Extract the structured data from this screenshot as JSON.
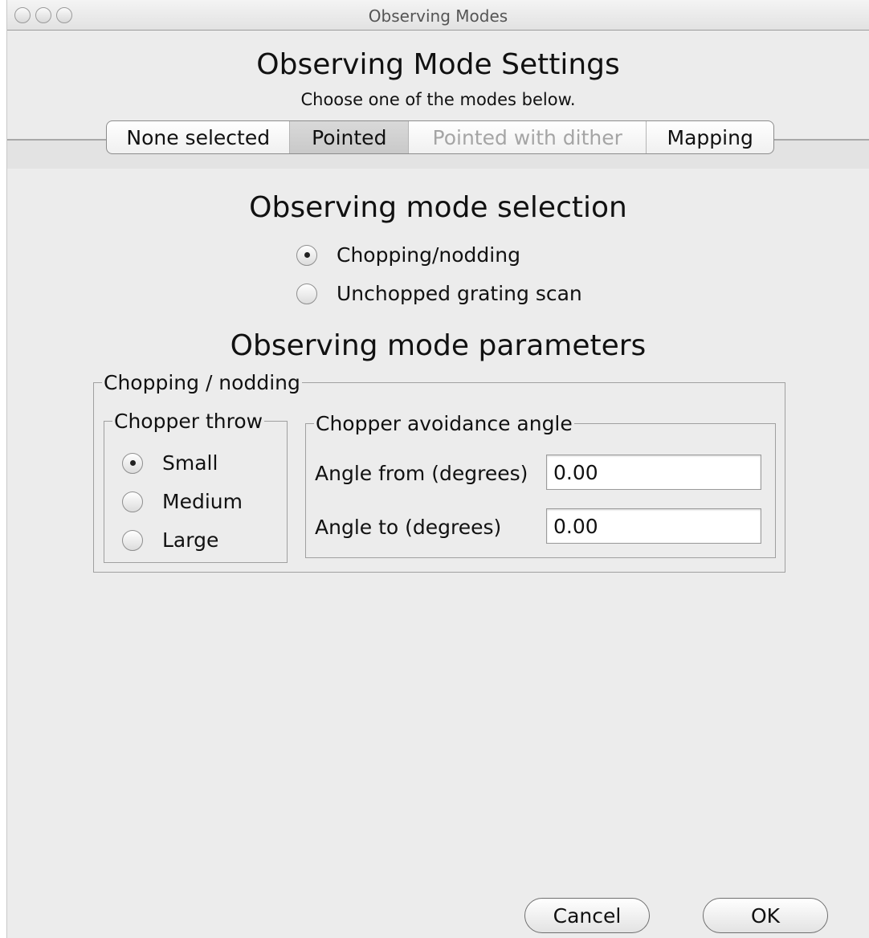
{
  "window": {
    "title": "Observing Modes"
  },
  "header": {
    "title": "Observing Mode Settings",
    "subtitle": "Choose one of the modes below."
  },
  "tabs": [
    {
      "label": "None selected",
      "state": "normal"
    },
    {
      "label": "Pointed",
      "state": "selected"
    },
    {
      "label": "Pointed with dither",
      "state": "disabled"
    },
    {
      "label": "Mapping",
      "state": "normal"
    }
  ],
  "mode_selection": {
    "title": "Observing mode selection",
    "options": [
      {
        "label": "Chopping/nodding",
        "selected": true
      },
      {
        "label": "Unchopped grating scan",
        "selected": false
      }
    ]
  },
  "mode_parameters": {
    "title": "Observing mode parameters",
    "group_title": "Chopping / nodding",
    "chopper_throw": {
      "title": "Chopper throw",
      "options": [
        {
          "label": "Small",
          "selected": true
        },
        {
          "label": "Medium",
          "selected": false
        },
        {
          "label": "Large",
          "selected": false
        }
      ]
    },
    "avoidance_angle": {
      "title": "Chopper avoidance angle",
      "from_label": "Angle from (degrees)",
      "from_value": "0.00",
      "to_label": "Angle to (degrees)",
      "to_value": "0.00"
    }
  },
  "buttons": {
    "cancel": "Cancel",
    "ok": "OK"
  }
}
